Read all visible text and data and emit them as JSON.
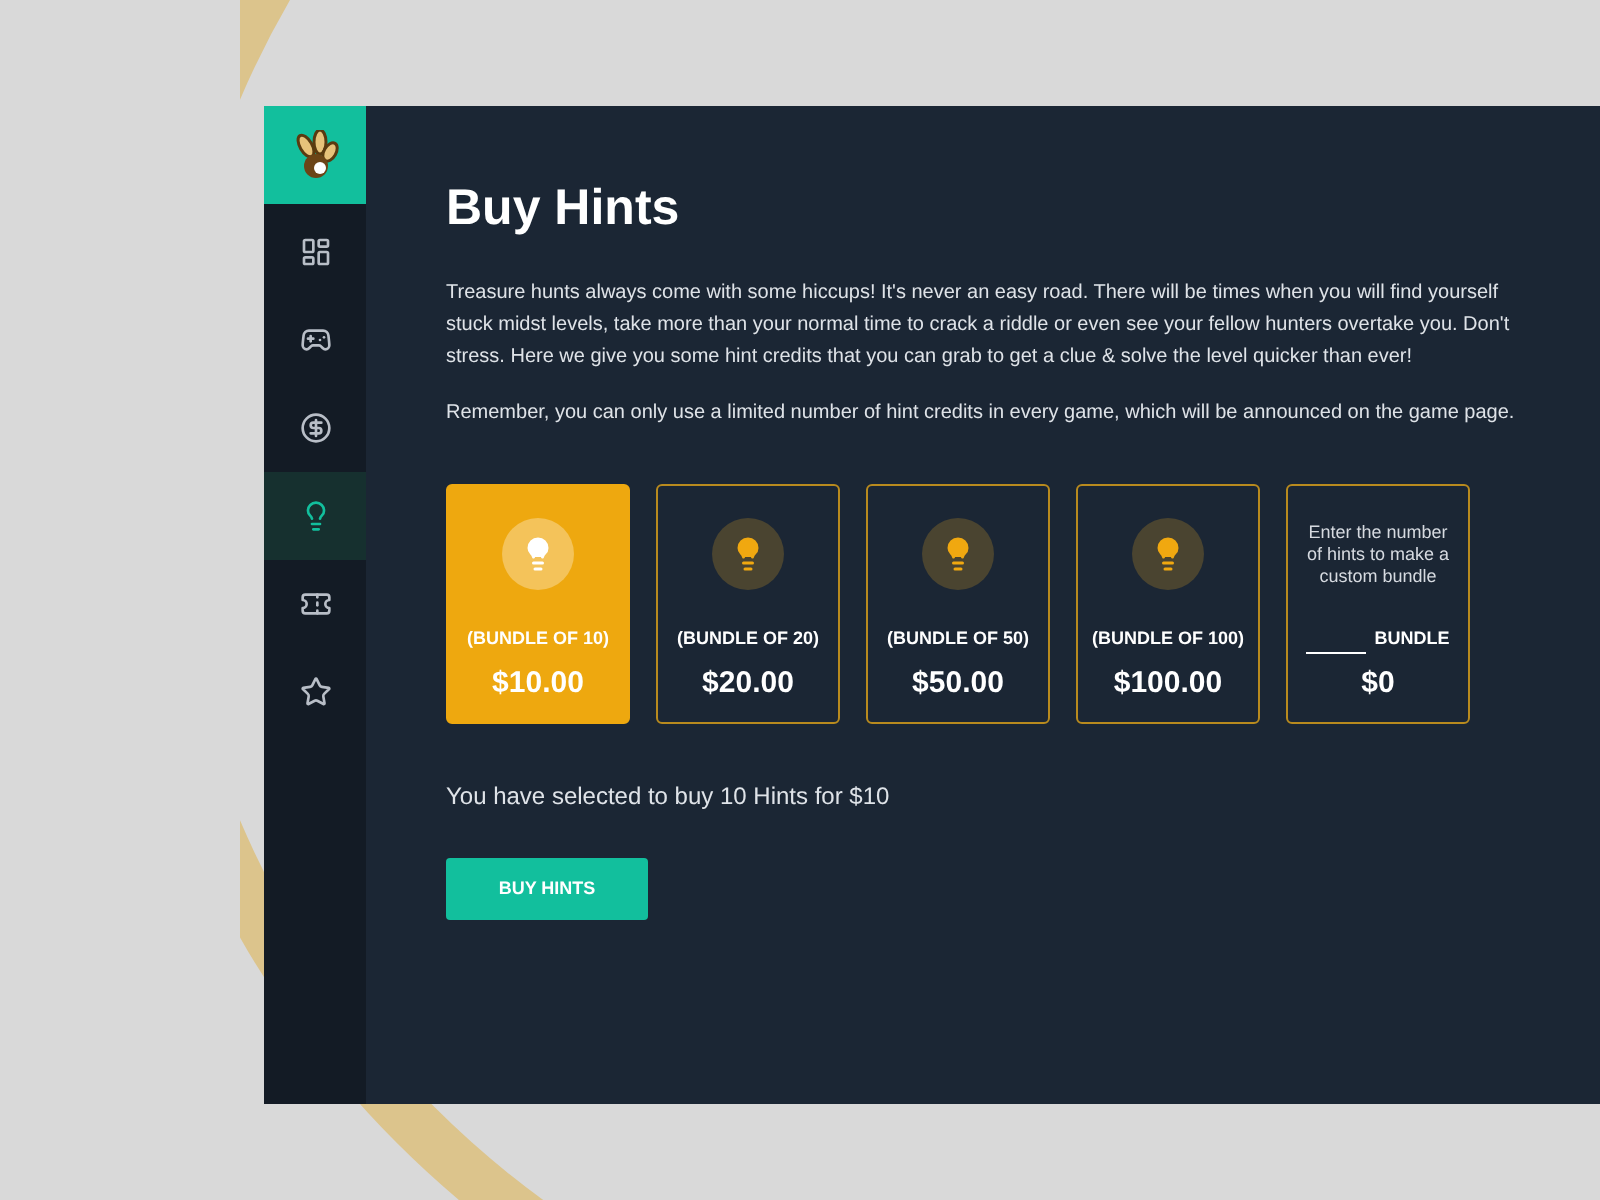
{
  "sidebar": {
    "items": [
      {
        "kind": "dashboard",
        "selected": false
      },
      {
        "kind": "gamepad",
        "selected": false
      },
      {
        "kind": "dollar",
        "selected": false
      },
      {
        "kind": "bulb",
        "selected": true
      },
      {
        "kind": "ticket",
        "selected": false
      },
      {
        "kind": "star",
        "selected": false
      }
    ]
  },
  "page": {
    "title": "Buy Hints",
    "paragraphs": [
      "Treasure hunts always come with some hiccups! It's never an easy road. There will be times when you will find yourself stuck midst levels, take more than your normal time to crack a riddle or even see your fellow hunters overtake you. Don't stress. Here we give you some hint credits that you can grab to get a clue & solve the level quicker than ever!",
      "Remember, you can only use a limited number of hint credits in every game, which will be announced on the game page."
    ]
  },
  "bundles": [
    {
      "kind": "preset",
      "label": "(BUNDLE OF 10)",
      "price": "$10.00",
      "selected": true
    },
    {
      "kind": "preset",
      "label": "(BUNDLE OF 20)",
      "price": "$20.00",
      "selected": false
    },
    {
      "kind": "preset",
      "label": "(BUNDLE OF 50)",
      "price": "$50.00",
      "selected": false
    },
    {
      "kind": "preset",
      "label": "(BUNDLE OF 100)",
      "price": "$100.00",
      "selected": false
    },
    {
      "kind": "custom",
      "hint": "Enter the number of hints to make a custom bundle",
      "label": "BUNDLE",
      "price": "$0",
      "selected": false
    }
  ],
  "summary": "You have selected to buy 10 Hints for $10",
  "buy_button": "BUY HINTS"
}
